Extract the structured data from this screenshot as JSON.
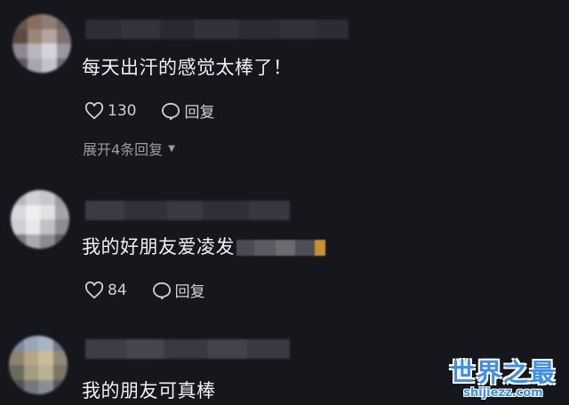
{
  "comments": [
    {
      "text": "每天出汗的感觉太棒了！",
      "likes": "130",
      "reply_label": "回复",
      "expand_label": "展开4条回复"
    },
    {
      "text": "我的好朋友爱凌发",
      "likes": "84",
      "reply_label": "回复"
    },
    {
      "text": "我的朋友可真棒"
    }
  ],
  "watermark": {
    "title": "世界之最",
    "url": "shijiezz.com"
  },
  "colors": {
    "background": "#16171d",
    "text": "#f0f0f2",
    "muted": "#9b9ca4",
    "watermark": "#3c8fe8"
  },
  "icons": [
    "heart-icon",
    "comment-bubble-icon",
    "caret-down-icon"
  ]
}
